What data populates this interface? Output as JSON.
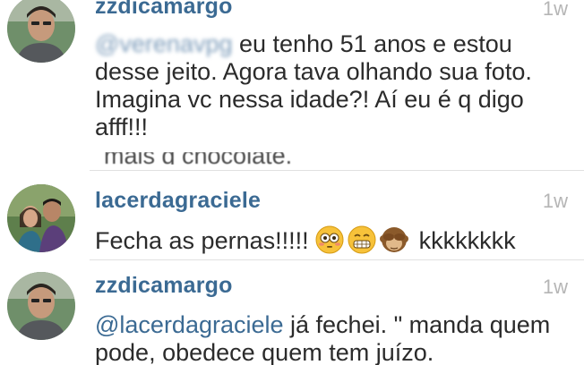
{
  "comments": [
    {
      "username": "zzdicamargo",
      "time": "1w",
      "mention": "@verenavpg",
      "text": " eu tenho 51 anos e estou desse jeito. Agora tava olhando sua foto. Imagina vc nessa idade?! Aí eu é q digo afff!!!",
      "overflow_text": "mais q chocolate."
    },
    {
      "username": "lacerdagraciele",
      "time": "1w",
      "text": "Fecha as pernas!!!!!",
      "emoji_icons": [
        "flushed-face-icon",
        "grimacing-face-icon",
        "see-no-evil-monkey-icon"
      ],
      "text_after": " kkkkkkkk"
    },
    {
      "username": "zzdicamargo",
      "time": "1w",
      "mention": "@lacerdagraciele",
      "text": " já fechei. \" manda quem pode, obedece quem tem juízo."
    }
  ],
  "colors": {
    "username": "#3b6a93",
    "text": "#2b2b2b",
    "time": "#b5b5b5",
    "divider": "#e1e1e1"
  }
}
